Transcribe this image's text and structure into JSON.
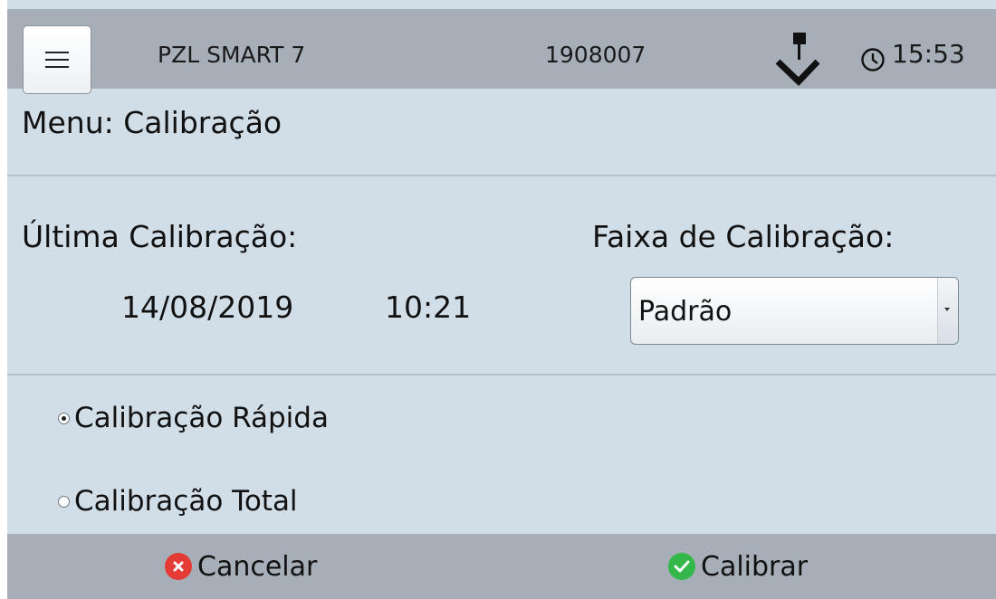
{
  "header": {
    "device_name": "PZL SMART 7",
    "serial": "1908007",
    "time": "15:53",
    "menu_icon": "hamburger-icon",
    "download_icon": "download-arrow-icon",
    "clock_icon": "clock-icon"
  },
  "page": {
    "title": "Menu: Calibração"
  },
  "last_calibration": {
    "label": "Última Calibração:",
    "date": "14/08/2019",
    "time": "10:21"
  },
  "range": {
    "label": "Faixa de Calibração:",
    "selected": "Padrão"
  },
  "options": [
    {
      "label": "Calibração Rápida",
      "checked": true
    },
    {
      "label": "Calibração Total",
      "checked": false
    }
  ],
  "footer": {
    "cancel_label": "Cancelar",
    "calibrate_label": "Calibrar"
  },
  "colors": {
    "bar": "#a6afb8",
    "panel": "#d2dee7",
    "cancel": "#e53b35",
    "confirm": "#34b84a"
  }
}
